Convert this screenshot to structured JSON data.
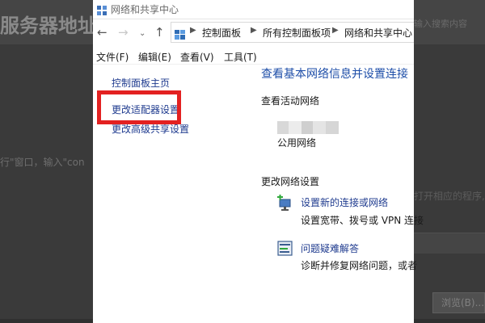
{
  "background": {
    "title": "服务器地址",
    "search_hint": "输入搜索内容",
    "middle_text": "行\"窗口，输入\"con",
    "right_text": "打开相应的程序,",
    "browse_button": "浏览(B)..."
  },
  "window": {
    "title": "网络和共享中心",
    "breadcrumbs": [
      "控制面板",
      "所有控制面板项",
      "网络和共享中心"
    ],
    "menu": [
      "文件(F)",
      "编辑(E)",
      "查看(V)",
      "工具(T)"
    ],
    "left_links": [
      "控制面板主页",
      "更改适配器设置",
      "更改高级共享设置"
    ],
    "main": {
      "heading": "查看基本网络信息并设置连接",
      "active_networks_label": "查看活动网络",
      "network_type": "公用网络",
      "change_settings_label": "更改网络设置",
      "tasks": [
        {
          "link": "设置新的连接或网络",
          "desc": "设置宽带、拨号或 VPN 连接",
          "icon": "network-setup-icon"
        },
        {
          "link": "问题疑难解答",
          "desc": "诊断并修复网络问题，或者",
          "icon": "troubleshoot-icon"
        }
      ]
    }
  },
  "colors": {
    "link": "#1f3b8f",
    "heading": "#1e4ea8",
    "highlight": "#e32121"
  }
}
